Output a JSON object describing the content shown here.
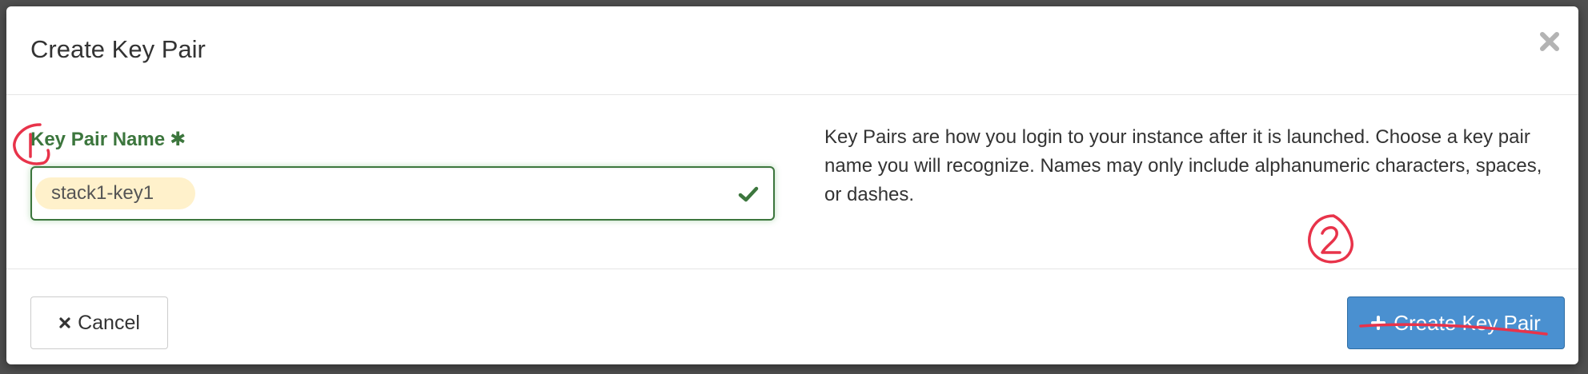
{
  "modal": {
    "title": "Create Key Pair",
    "close_icon": "close-icon"
  },
  "form": {
    "label": "Key Pair Name",
    "required_marker": "✱",
    "input_value": "stack1-key1",
    "valid_icon": "check-icon"
  },
  "help": {
    "text": "Key Pairs are how you login to your instance after it is launched. Choose a key pair name you will recognize. Names may only include alphanumeric characters, spaces, or dashes."
  },
  "footer": {
    "cancel_label": "Cancel",
    "create_label": "Create Key Pair"
  },
  "annotations": {
    "step1": "1",
    "step2": "2"
  },
  "colors": {
    "success": "#3c763d",
    "primary": "#4a90d0",
    "annotation": "#e8334a"
  }
}
